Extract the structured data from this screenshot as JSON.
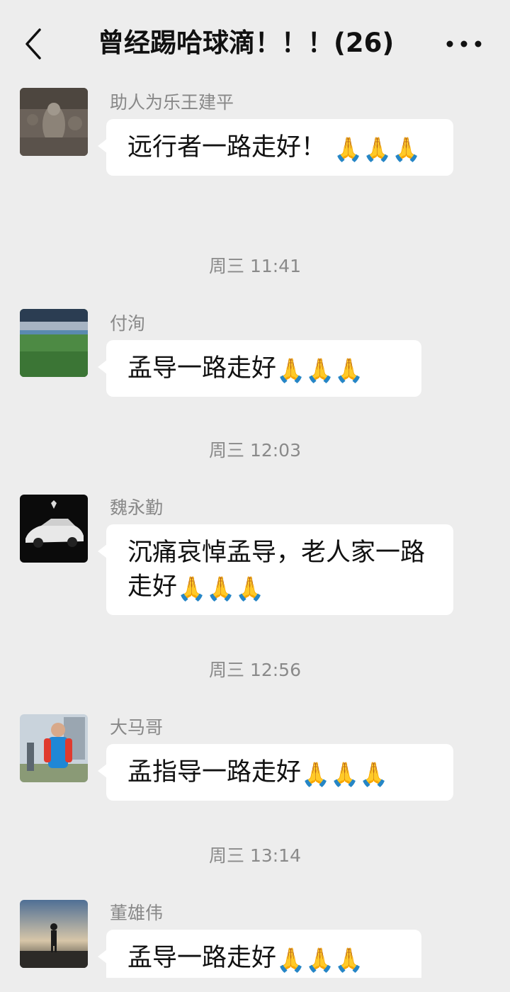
{
  "header": {
    "title": "曾经踢哈球滴！！！(26)"
  },
  "messages": [
    {
      "sender": "助人为乐王建平",
      "text": "远行者一路走好！ ",
      "emoji": "🙏🙏🙏"
    },
    {
      "sender": "付洵",
      "text": "孟导一路走好",
      "emoji": "🙏🙏🙏"
    },
    {
      "sender": "魏永勤",
      "text": "沉痛哀悼孟导，老人家一路走好",
      "emoji": "🙏🙏🙏"
    },
    {
      "sender": "大马哥",
      "text": "孟指导一路走好",
      "emoji": "🙏🙏🙏"
    },
    {
      "sender": "董雄伟",
      "text": "孟导一路走好",
      "emoji": "🙏🙏🙏"
    }
  ],
  "timestamps": [
    "周三 11:41",
    "周三 12:03",
    "周三 12:56",
    "周三 13:14"
  ],
  "colors": {
    "background": "#ededed",
    "bubble": "#ffffff",
    "meta_text": "#888888"
  },
  "icons": {
    "back": "chevron-left-icon",
    "more": "more-dots-icon"
  }
}
